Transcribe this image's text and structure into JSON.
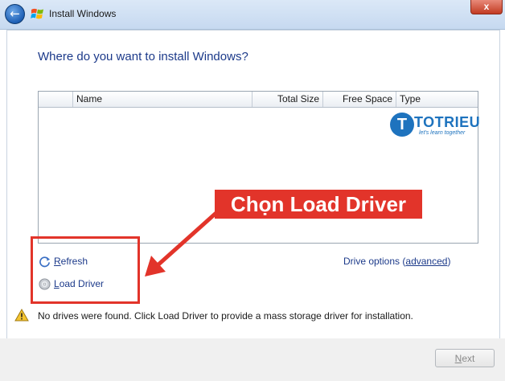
{
  "window": {
    "title": "Install Windows",
    "close_label": "x"
  },
  "page": {
    "heading": "Where do you want to install Windows?"
  },
  "table": {
    "columns": [
      {
        "label": ""
      },
      {
        "label": "Name"
      },
      {
        "label": "Total Size"
      },
      {
        "label": "Free Space"
      },
      {
        "label": "Type"
      }
    ],
    "rows": []
  },
  "watermark": {
    "logo_letter": "T",
    "name": "TOTRIEU",
    "tagline": "let's learn together"
  },
  "annotation": {
    "callout_text": "Chọn Load Driver",
    "color": "#e2342a"
  },
  "links": {
    "refresh": {
      "accel": "R",
      "rest": "efresh",
      "icon": "refresh-icon"
    },
    "load_driver": {
      "accel": "L",
      "rest": "oad Driver",
      "icon": "disc-icon"
    },
    "drive_options": {
      "prefix": "Drive options (",
      "accel": "a",
      "rest": "dvanced",
      "suffix": ")"
    }
  },
  "warning": {
    "icon": "warning-icon",
    "text": "No drives were found. Click Load Driver to provide a mass storage driver for installation."
  },
  "footer": {
    "next_accel": "N",
    "next_rest": "ext",
    "next_enabled": false
  }
}
